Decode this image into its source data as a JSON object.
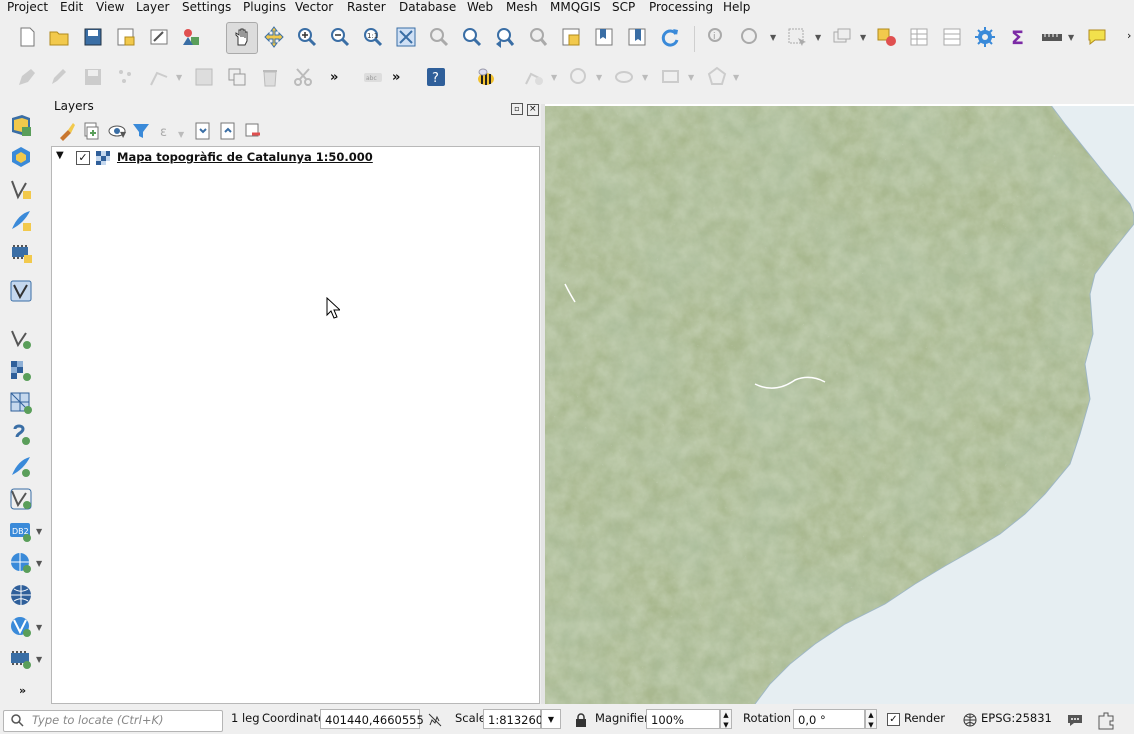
{
  "menu": [
    "Project",
    "Edit",
    "View",
    "Layer",
    "Settings",
    "Plugins",
    "Vector",
    "Raster",
    "Database",
    "Web",
    "Mesh",
    "MMQGIS",
    "SCP",
    "Processing",
    "Help"
  ],
  "layers_panel": {
    "title": "Layers",
    "layer": {
      "name": "Mapa topogràfic de Catalunya 1:50.000",
      "checked": true
    }
  },
  "toolbar": {
    "more1": "»",
    "more2": "»",
    "more_menu": "»"
  },
  "statusbar": {
    "locate_placeholder": "Type to locate (Ctrl+K)",
    "legend_text": "1 leg",
    "coordinate_label": "Coordinate",
    "coordinate_value": "401440,4660555",
    "scale_label": "Scale",
    "scale_value": "1:813260",
    "magnifier_label": "Magnifier",
    "magnifier_value": "100%",
    "rotation_label": "Rotation",
    "rotation_value": "0,0 °",
    "render_label": "Render",
    "render_checked": true,
    "crs": "EPSG:25831"
  },
  "colors": {
    "accent_blue": "#2f6fbf",
    "map_green": "#8da472",
    "sea": "#e6eef2"
  }
}
